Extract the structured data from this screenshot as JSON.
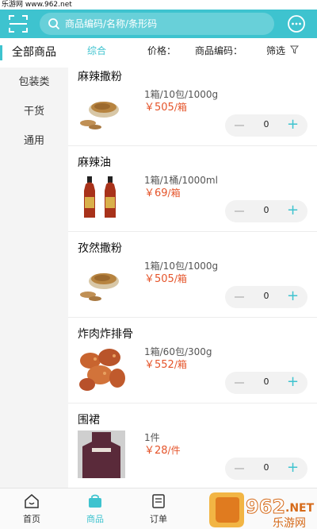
{
  "watermark_top": "乐游网 www.962.net",
  "search": {
    "placeholder": "商品编码/名称/条形码"
  },
  "sidebar": {
    "items": [
      {
        "label": "全部商品"
      },
      {
        "label": "包装类"
      },
      {
        "label": "干货"
      },
      {
        "label": "通用"
      }
    ]
  },
  "filters": {
    "comprehensive": "综合",
    "price": "价格：",
    "code": "商品编码：",
    "filter": "筛选"
  },
  "products": [
    {
      "name": "麻辣撒粉",
      "spec": "1箱/10包/1000g",
      "price": "￥505",
      "unit": "/箱",
      "qty": "0",
      "image": "spice-powder"
    },
    {
      "name": "麻辣油",
      "spec": "1箱/1桶/1000ml",
      "price": "￥69",
      "unit": "/箱",
      "qty": "0",
      "image": "chili-oil-bottles"
    },
    {
      "name": "孜然撒粉",
      "spec": "1箱/10包/1000g",
      "price": "￥505",
      "unit": "/箱",
      "qty": "0",
      "image": "spice-powder"
    },
    {
      "name": "炸肉炸排骨",
      "spec": "1箱/60包/300g",
      "price": "￥552",
      "unit": "/箱",
      "qty": "0",
      "image": "fried-pork"
    },
    {
      "name": "围裙",
      "spec": "1件",
      "price": "￥28",
      "unit": "/件",
      "qty": "0",
      "image": "apron"
    }
  ],
  "tabbar": {
    "tabs": [
      {
        "label": "首页",
        "icon": "home-icon"
      },
      {
        "label": "商品",
        "icon": "goods-icon"
      },
      {
        "label": "订单",
        "icon": "order-icon"
      }
    ]
  },
  "watermark_corner": {
    "logo": "962",
    "suffix": ".NET",
    "text": "乐游网"
  },
  "colors": {
    "accent": "#3ec3cf",
    "price": "#e5542a"
  }
}
